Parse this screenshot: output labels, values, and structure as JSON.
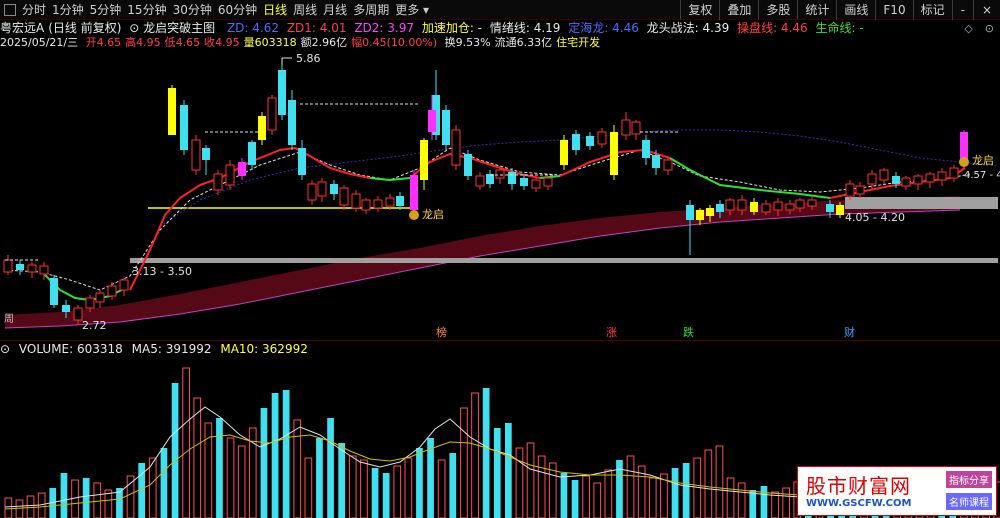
{
  "toolbar": {
    "periods": [
      "分时",
      "1分钟",
      "5分钟",
      "15分钟",
      "30分钟",
      "60分钟",
      "日线",
      "周线",
      "月线",
      "多周期",
      "更多"
    ],
    "active_period": "日线",
    "right_buttons": [
      "复权",
      "叠加",
      "多股",
      "统计",
      "画线",
      "F10",
      "标记",
      "-",
      "×"
    ]
  },
  "stock": {
    "title": "粤宏远A",
    "mode": "(日线 前复权)",
    "indicator_name": "龙启突破主图"
  },
  "indicators": {
    "zd": "ZD: 4.62",
    "zd1": "ZD1: 4.01",
    "zd2": "ZD2: 3.97",
    "jiasu": "加速加仓: -",
    "qingxu": "情绪线: 4.19",
    "dingding": "定海龙: 4.46",
    "longtou": "龙头战法: 4.39",
    "caopan": "操盘线: 4.46",
    "shengming": "生命线: -"
  },
  "bar_info": {
    "date": "2025/05/21/三",
    "open": "开4.65",
    "high": "高4.95",
    "low": "低4.65",
    "close": "收4.95",
    "volume": "量603318",
    "amount": "额2.96亿",
    "change": "幅0.45(10.00%)",
    "turnover": "换9.53%",
    "float": "流通6.33亿",
    "sector": "住宅开发"
  },
  "chart_labels": {
    "peak": "5.86",
    "low": "2.72",
    "range1": "3.13 - 3.50",
    "range2": "4.05 - 4.20",
    "right_price": "4.57 - 4",
    "longqi1": "龙启",
    "longqi2": "龙启",
    "mark_bang": "榜",
    "mark_zhang": "涨",
    "mark_die": "跌",
    "mark_cai": "财",
    "corner_left": "周"
  },
  "volume_info": {
    "volume": "VOLUME: 603318",
    "ma5": "MA5: 391992",
    "ma10": "MA10: 362992"
  },
  "watermark": {
    "title": "股市财富网",
    "url": "WWW.GSCFW.COM",
    "badge1": "指标分享",
    "badge2": "名师课程"
  },
  "colors": {
    "up": "#ff3030",
    "down": "#40e0f0",
    "yellow": "#ffff00",
    "magenta": "#ff30ff",
    "ma_blue": "#3a3acf",
    "volume_up": "#ff5050",
    "volume_down": "#40e0f0"
  }
}
